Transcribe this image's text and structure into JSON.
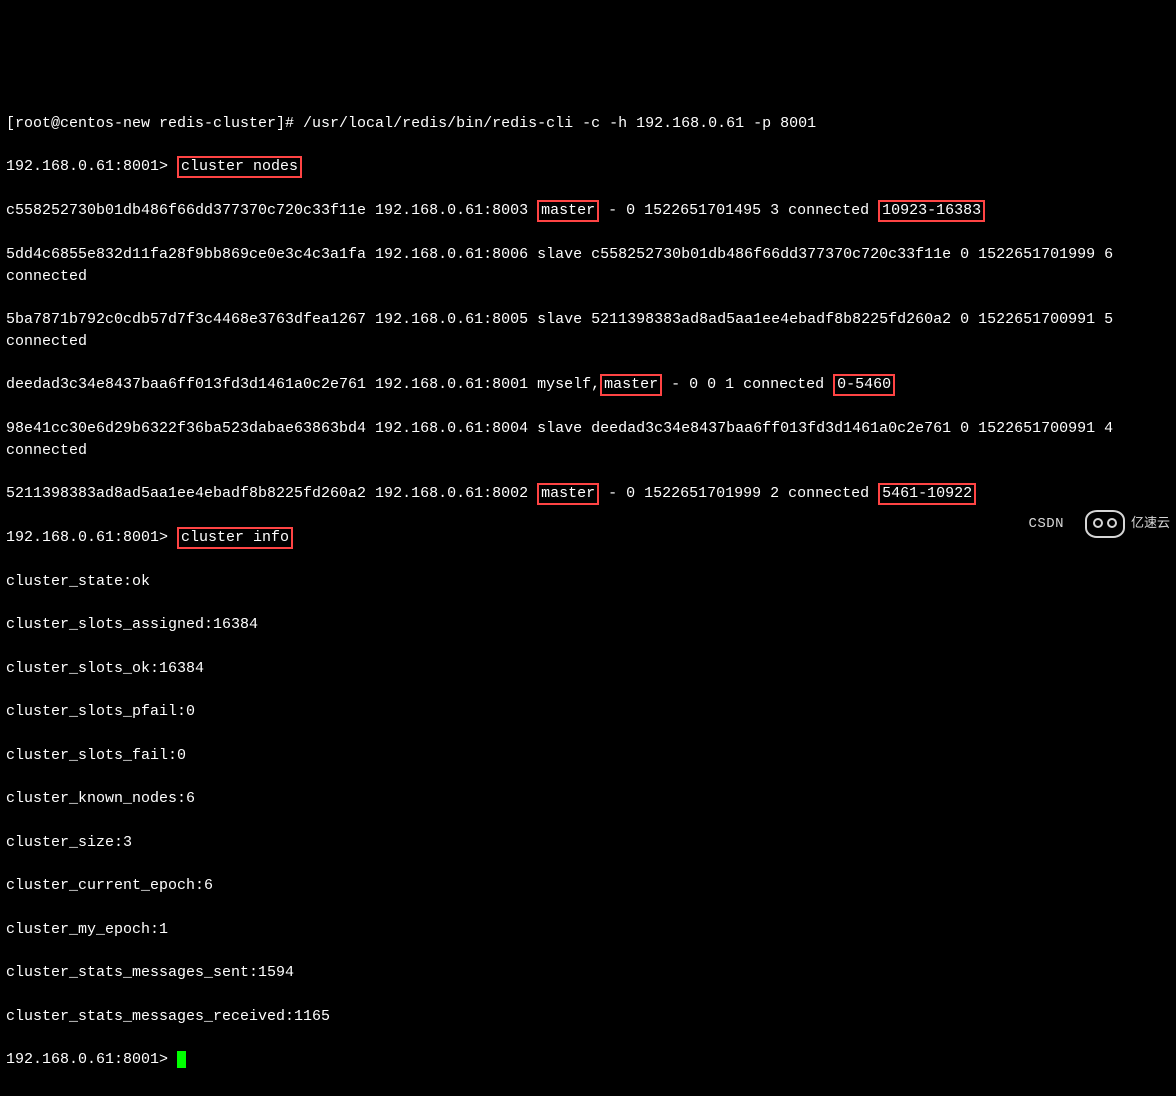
{
  "prompt_start": "[root@centos-new redis-cluster]# /usr/local/redis/bin/redis-cli -c -h 192.168.0.61 -p 8001",
  "cli_prompt": "192.168.0.61:8001> ",
  "cmd_cluster_nodes": "cluster nodes",
  "cmd_cluster_info": "cluster info",
  "node1_a": "c558252730b01db486f66dd377370c720c33f11e 192.168.0.61:8003 ",
  "node1_master": "master",
  "node1_b": " - 0 1522651701495 3 connected ",
  "node1_slots": "10923-16383",
  "node2": "5dd4c6855e832d11fa28f9bb869ce0e3c4c3a1fa 192.168.0.61:8006 slave c558252730b01db486f66dd377370c720c33f11e 0 1522651701999 6 connected",
  "node3": "5ba7871b792c0cdb57d7f3c4468e3763dfea1267 192.168.0.61:8005 slave 5211398383ad8ad5aa1ee4ebadf8b8225fd260a2 0 1522651700991 5 connected",
  "node4_a": "deedad3c34e8437baa6ff013fd3d1461a0c2e761 192.168.0.61:8001 myself,",
  "node4_master": "master",
  "node4_b": " - 0 0 1 connected ",
  "node4_slots": "0-5460",
  "node5": "98e41cc30e6d29b6322f36ba523dabae63863bd4 192.168.0.61:8004 slave deedad3c34e8437baa6ff013fd3d1461a0c2e761 0 1522651700991 4 connected",
  "node6_a": "5211398383ad8ad5aa1ee4ebadf8b8225fd260a2 192.168.0.61:8002 ",
  "node6_master": "master",
  "node6_b": " - 0 1522651701999 2 connected ",
  "node6_slots": "5461-10922",
  "info": {
    "l1": "cluster_state:ok",
    "l2": "cluster_slots_assigned:16384",
    "l3": "cluster_slots_ok:16384",
    "l4": "cluster_slots_pfail:0",
    "l5": "cluster_slots_fail:0",
    "l6": "cluster_known_nodes:6",
    "l7": "cluster_size:3",
    "l8": "cluster_current_epoch:6",
    "l9": "cluster_my_epoch:1",
    "l10": "cluster_stats_messages_sent:1594",
    "l11": "cluster_stats_messages_received:1165"
  },
  "watermark_csdn": "CSDN ",
  "watermark_text": "亿速云"
}
